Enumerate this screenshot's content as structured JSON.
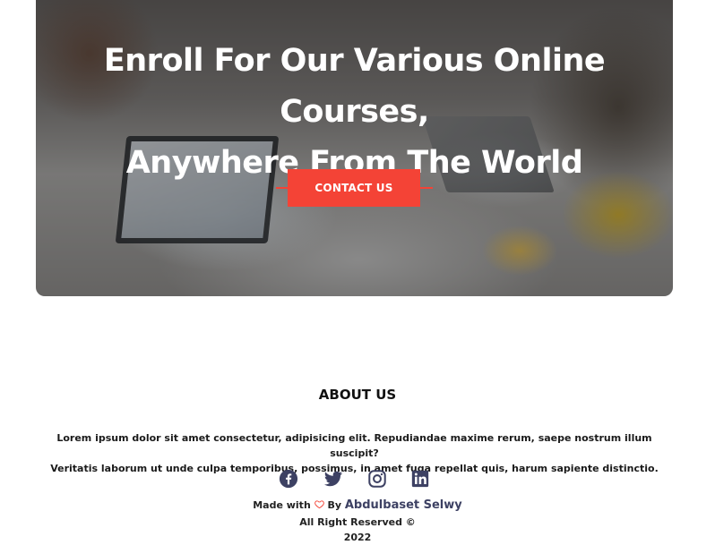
{
  "hero": {
    "title_line1": "Enroll For Our Various Online Courses,",
    "title_line2": "Anywhere From The World",
    "cta_label": "CONTACT US",
    "accent_color": "#f44336"
  },
  "about": {
    "title": "ABOUT US",
    "text_line1": "Lorem ipsum dolor sit amet consectetur, adipisicing elit. Repudiandae maxime rerum, saepe nostrum illum suscipit?",
    "text_line2": "Veritatis laborum ut unde culpa temporibus, possimus, in amet fuga repellat quis, harum sapiente distinctio."
  },
  "socials": [
    {
      "name": "facebook-icon"
    },
    {
      "name": "twitter-icon"
    },
    {
      "name": "instagram-icon"
    },
    {
      "name": "linkedin-icon"
    }
  ],
  "footer": {
    "made_with_prefix": "Made with",
    "made_with_by": "By",
    "author": "Abdulbaset Selwy",
    "rights": "All Right Reserved ©",
    "year": "2022",
    "icon_color": "#3d4163"
  }
}
